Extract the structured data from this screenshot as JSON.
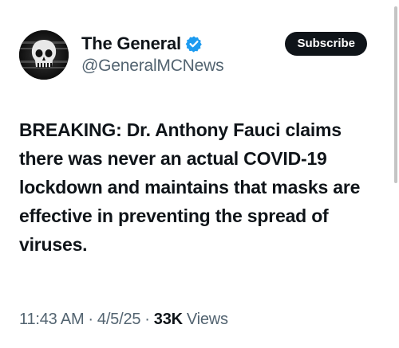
{
  "author": {
    "display_name": "The General",
    "handle": "@GeneralMCNews",
    "verified_icon": "verified-badge-icon",
    "avatar_icon": "punisher-skull-avatar"
  },
  "actions": {
    "subscribe_label": "Subscribe"
  },
  "tweet": {
    "text": "BREAKING: Dr. Anthony Fauci claims there was never an actual COVID-19 lockdown and maintains that masks are effective in preventing the spread of viruses."
  },
  "meta": {
    "time": "11:43 AM",
    "separator": "·",
    "date": "4/5/25",
    "views_count": "33K",
    "views_label": "Views"
  },
  "colors": {
    "text_primary": "#0f1419",
    "text_secondary": "#536471",
    "verified_blue": "#1d9bf0",
    "button_bg": "#0f1419"
  }
}
